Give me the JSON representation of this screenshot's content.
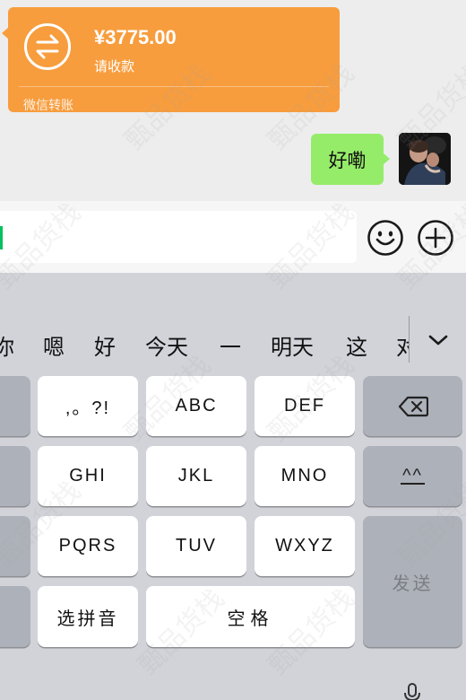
{
  "transfer": {
    "amount": "¥3775.00",
    "status": "请收款",
    "source": "微信转账",
    "icon": "transfer-arrows-icon",
    "color": "#f79d3e"
  },
  "message": {
    "text": "好嘞",
    "bubble_color": "#95ec69"
  },
  "input": {
    "value": "",
    "cursor_color": "#07c160",
    "emoji_icon": "emoji-icon",
    "plus_icon": "plus-icon"
  },
  "keyboard": {
    "candidates": [
      "你",
      "嗯",
      "好",
      "今天",
      "一",
      "明天",
      "这",
      "对"
    ],
    "expand_icon": "chevron-down-icon",
    "rows": [
      [
        ",。?!",
        "ABC",
        "DEF"
      ],
      [
        "GHI",
        "JKL",
        "MNO"
      ],
      [
        "PQRS",
        "TUV",
        "WXYZ"
      ]
    ],
    "delete_icon": "backspace-icon",
    "emoticon_label": "^^",
    "send_label": "发送",
    "pinyin_label": "选拼音",
    "space_label": "空格",
    "mic_icon": "microphone-icon"
  },
  "watermark_text": "甄品货栈"
}
